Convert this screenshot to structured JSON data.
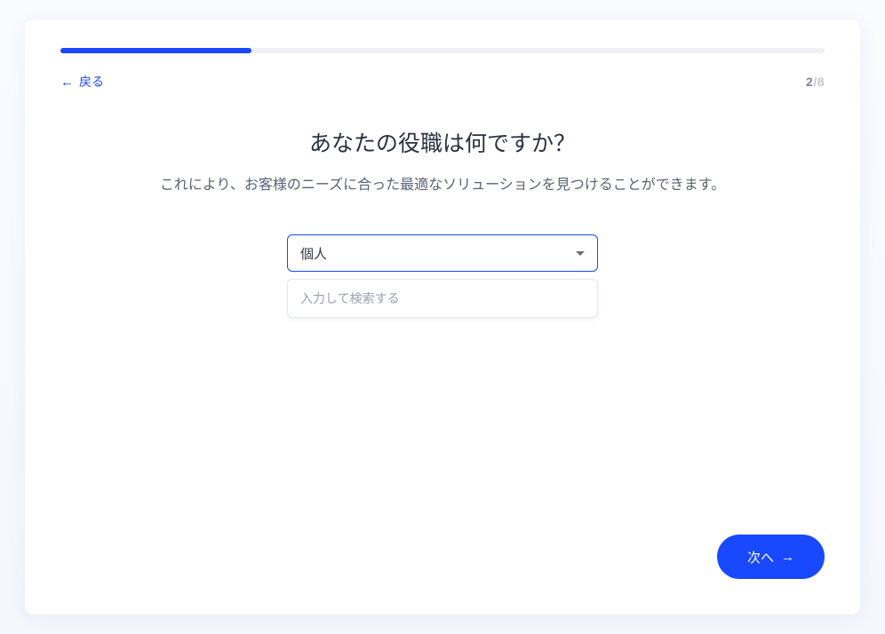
{
  "progress": {
    "percent": 25
  },
  "nav": {
    "back_label": "戻る"
  },
  "step": {
    "current": "2",
    "sep": "/",
    "total": "8"
  },
  "heading": "あなたの役職は何ですか？",
  "subtitle": "これにより、お客様のニーズに合った最適なソリューションを見つけることができます。",
  "dropdown": {
    "selected": "個人"
  },
  "search": {
    "placeholder": "入力して検索する"
  },
  "actions": {
    "next_label": "次へ"
  }
}
